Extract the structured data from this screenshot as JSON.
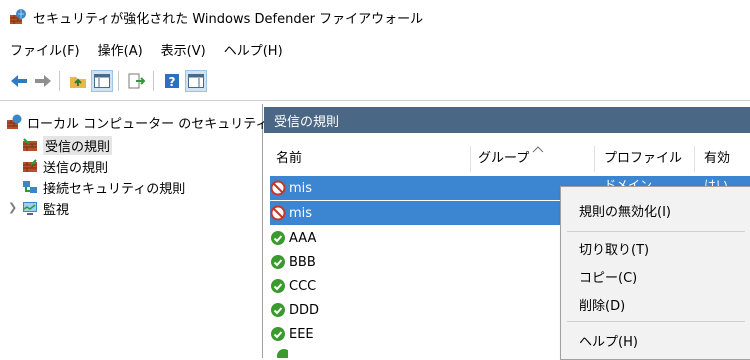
{
  "window": {
    "title": "セキュリティが強化された Windows Defender ファイアウォール"
  },
  "menu": [
    "ファイル(F)",
    "操作(A)",
    "表示(V)",
    "ヘルプ(H)"
  ],
  "tree": {
    "root": "ローカル コンピューター のセキュリティ:",
    "items": [
      "受信の規則",
      "送信の規則",
      "接続セキュリティの規則",
      "監視"
    ]
  },
  "pane": {
    "header": "受信の規則",
    "columns": [
      "名前",
      "グループ",
      "プロファイル",
      "有効"
    ]
  },
  "rows": [
    {
      "name": "mis",
      "status": "blocked",
      "profile": "ドメイン",
      "enabled": "はい"
    },
    {
      "name": "mis",
      "status": "blocked"
    },
    {
      "name": "AAA",
      "status": "allowed"
    },
    {
      "name": "BBB",
      "status": "allowed"
    },
    {
      "name": "CCC",
      "status": "allowed"
    },
    {
      "name": "DDD",
      "status": "allowed"
    },
    {
      "name": "EEE",
      "status": "allowed"
    }
  ],
  "context_menu": {
    "items": [
      "規則の無効化(I)",
      "切り取り(T)",
      "コピー(C)",
      "削除(D)",
      "ヘルプ(H)"
    ]
  },
  "colors": {
    "accent": "#3c85d1",
    "pane_header": "#4a6785",
    "allow": "#3a9a2e",
    "block": "#c0392b"
  }
}
